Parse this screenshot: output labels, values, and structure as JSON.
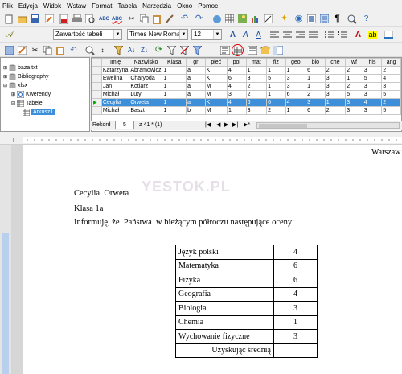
{
  "menu": [
    "Plik",
    "Edycja",
    "Widok",
    "Wstaw",
    "Format",
    "Tabela",
    "Narzędzia",
    "Okno",
    "Pomoc"
  ],
  "format_bar": {
    "style": "Zawartość tabeli",
    "font": "Times New Roman",
    "size": "12"
  },
  "tree": {
    "items": [
      "baza txt",
      "Bibliography",
      "xlsx",
      "Kwerendy",
      "Tabele",
      "Arkusz1"
    ]
  },
  "grid": {
    "columns": [
      "Imię",
      "Nazwisko",
      "Klasa",
      "gr",
      "płeć",
      "pol",
      "mat",
      "fiz",
      "geo",
      "bio",
      "che",
      "wf",
      "his",
      "ang"
    ],
    "rows": [
      [
        "Katarzyna",
        "Abramowicz",
        "1",
        "a",
        "K",
        "4",
        "1",
        "1",
        "1",
        "6",
        "2",
        "2",
        "3",
        "2"
      ],
      [
        "Ewelina",
        "Charybda",
        "1",
        "a",
        "K",
        "6",
        "3",
        "5",
        "3",
        "1",
        "3",
        "1",
        "5",
        "4"
      ],
      [
        "Jan",
        "Kotlarz",
        "1",
        "a",
        "M",
        "4",
        "2",
        "1",
        "3",
        "1",
        "3",
        "2",
        "3",
        "3"
      ],
      [
        "Michał",
        "Luty",
        "1",
        "a",
        "M",
        "3",
        "2",
        "1",
        "6",
        "2",
        "3",
        "5",
        "3",
        "5"
      ],
      [
        "Cecylia",
        "Orweta",
        "1",
        "a",
        "K",
        "4",
        "6",
        "6",
        "4",
        "3",
        "1",
        "3",
        "4",
        "2"
      ],
      [
        "Michał",
        "Baszt",
        "1",
        "b",
        "M",
        "1",
        "3",
        "2",
        "1",
        "6",
        "2",
        "3",
        "3",
        "5"
      ]
    ],
    "highlight_row": 4
  },
  "record_bar": {
    "label": "Rekord",
    "current": "5",
    "of": "z 41 * (1)"
  },
  "document": {
    "city": "Warszaw",
    "watermark": "YESTOK.PL",
    "name": "Cecylia  Orweta",
    "class_line": "Klasa 1a",
    "intro": "Informuję, że  Państwa  w bieżącym półroczu następujące oceny:",
    "grades": [
      {
        "subject": "Język polski",
        "grade": "4"
      },
      {
        "subject": "Matematyka",
        "grade": "6"
      },
      {
        "subject": "Fizyka",
        "grade": "6"
      },
      {
        "subject": "Geografia",
        "grade": "4"
      },
      {
        "subject": "Biologia",
        "grade": "3"
      },
      {
        "subject": "Chemia",
        "grade": "1"
      },
      {
        "subject": "Wychowanie fizyczne",
        "grade": "3"
      }
    ],
    "average_label": "Uzyskując średnią"
  },
  "colors": {
    "highlight": "#3c8fd8",
    "selected_tree": "#3c8fd8",
    "toolbar_bg": "#f0f0f0"
  },
  "icons": [
    "new-doc-icon",
    "open-icon",
    "save-icon",
    "print-icon",
    "pdf-icon",
    "spellcheck-icon",
    "cut-icon",
    "copy-icon",
    "paste-icon",
    "undo-icon",
    "redo-icon",
    "find-icon",
    "table-icon",
    "chart-icon",
    "bold-icon",
    "italic-icon",
    "underline-icon",
    "align-left-icon",
    "align-center-icon",
    "align-right-icon",
    "justify-icon",
    "filter-icon",
    "sort-asc-icon",
    "sort-desc-icon",
    "data-to-text-icon",
    "form-letter-icon",
    "data-source-icon",
    "explorer-icon"
  ]
}
